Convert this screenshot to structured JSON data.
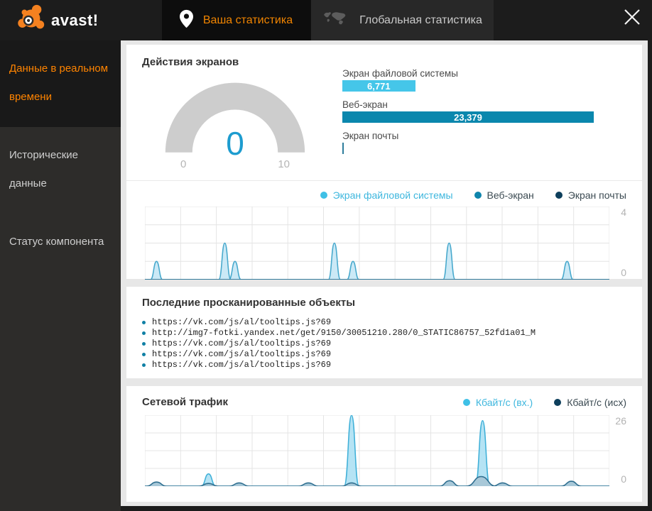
{
  "app": {
    "logo_text": "avast!"
  },
  "tabs": [
    {
      "label": "Ваша статистика",
      "active": true
    },
    {
      "label": "Глобальная статистика",
      "active": false
    }
  ],
  "sidebar": {
    "items": [
      {
        "label": "Данные в реальном времени",
        "active": true
      },
      {
        "label": "Исторические данные",
        "active": false
      },
      {
        "label": "Статус компонента",
        "active": false
      }
    ]
  },
  "screens_panel": {
    "title": "Действия экранов",
    "gauge": {
      "value": "0",
      "min": "0",
      "max": "10"
    },
    "bars": [
      {
        "label": "Экран файловой системы",
        "value": "6,771",
        "width_pct": 29,
        "color": "#45c6e9"
      },
      {
        "label": "Веб-экран",
        "value": "23,379",
        "width_pct": 100,
        "color": "#0a87ad"
      },
      {
        "label": "Экран почты",
        "value": "",
        "width_pct": 0.5,
        "color": "#2d7d9c"
      }
    ],
    "legend": [
      {
        "label": "Экран файловой системы",
        "dot": "#3fc0e6",
        "text_color": "#3eb7de"
      },
      {
        "label": "Веб-экран",
        "dot": "#0f85ac",
        "text_color": "#3b4a52"
      },
      {
        "label": "Экран почты",
        "dot": "#0d3f5c",
        "text_color": "#3b4a52"
      }
    ]
  },
  "scanned_panel": {
    "title": "Последние просканированные объекты",
    "items": [
      "https://vk.com/js/al/tooltips.js?69",
      "http://img7-fotki.yandex.net/get/9150/30051210.280/0_STATIC86757_52fd1a01_M",
      "https://vk.com/js/al/tooltips.js?69",
      "https://vk.com/js/al/tooltips.js?69",
      "https://vk.com/js/al/tooltips.js?69"
    ]
  },
  "network_panel": {
    "title": "Сетевой трафик",
    "legend": [
      {
        "label": "Кбайт/с (вх.)",
        "dot": "#3fc0e6",
        "text_color": "#3eb7de"
      },
      {
        "label": "Кбайт/с (исх)",
        "dot": "#0d3f5c",
        "text_color": "#3b4a52"
      }
    ]
  },
  "chart_data": [
    {
      "type": "area",
      "title": "Действия экранов — активность в реальном времени",
      "ylim": [
        0,
        4
      ],
      "tick_top": "4",
      "tick_bottom": "0",
      "grid": {
        "cols": 13,
        "rows": 4
      },
      "legend_position": "top-right",
      "series": [
        {
          "name": "Экран файловой системы",
          "fill": "#cbe9f6",
          "stroke": "#46a8cc",
          "spike_w": 1.3,
          "spikes": [
            {
              "x": 2.5,
              "h": 1
            },
            {
              "x": 17.2,
              "h": 2
            },
            {
              "x": 19.4,
              "h": 1
            },
            {
              "x": 40.8,
              "h": 2
            },
            {
              "x": 44.8,
              "h": 1
            },
            {
              "x": 65.5,
              "h": 2
            },
            {
              "x": 90.9,
              "h": 1
            }
          ]
        },
        {
          "name": "Экран почты",
          "fill": "none",
          "stroke": "#0d3f5c",
          "spike_w": 1.3,
          "spikes": []
        },
        {
          "name": "Веб-экран",
          "fill": "none",
          "stroke": "#27789b",
          "spike_w": 1.3,
          "spikes": []
        }
      ]
    },
    {
      "type": "area",
      "title": "Сетевой трафик",
      "ylim": [
        0,
        26
      ],
      "tick_top": "26",
      "tick_bottom": "0",
      "grid": {
        "cols": 13,
        "rows": 4
      },
      "legend_position": "top-right",
      "series": [
        {
          "name": "Кбайт/с (вх.)",
          "fill": "#b5e3f4",
          "stroke": "#3fb0d8",
          "spike_w": 1.6,
          "spikes": [
            {
              "x": 13.7,
              "h": 4.5
            },
            {
              "x": 44.5,
              "h": 26
            },
            {
              "x": 72.7,
              "h": 24
            }
          ]
        },
        {
          "name": "Кбайт/с (исх)",
          "fill": "#a8c8d8",
          "stroke": "#2e6e8f",
          "spike_w": 2.2,
          "spikes": [
            {
              "x": 2.5,
              "h": 1.5
            },
            {
              "x": 13.7,
              "h": 1
            },
            {
              "x": 20.3,
              "h": 1.2
            },
            {
              "x": 35.2,
              "h": 1.2
            },
            {
              "x": 44.5,
              "h": 1.2
            },
            {
              "x": 65.6,
              "h": 2
            },
            {
              "x": 72.4,
              "h": 3.5,
              "w": 3.2
            },
            {
              "x": 77,
              "h": 1.2
            },
            {
              "x": 91.8,
              "h": 1.8
            }
          ]
        }
      ]
    }
  ]
}
